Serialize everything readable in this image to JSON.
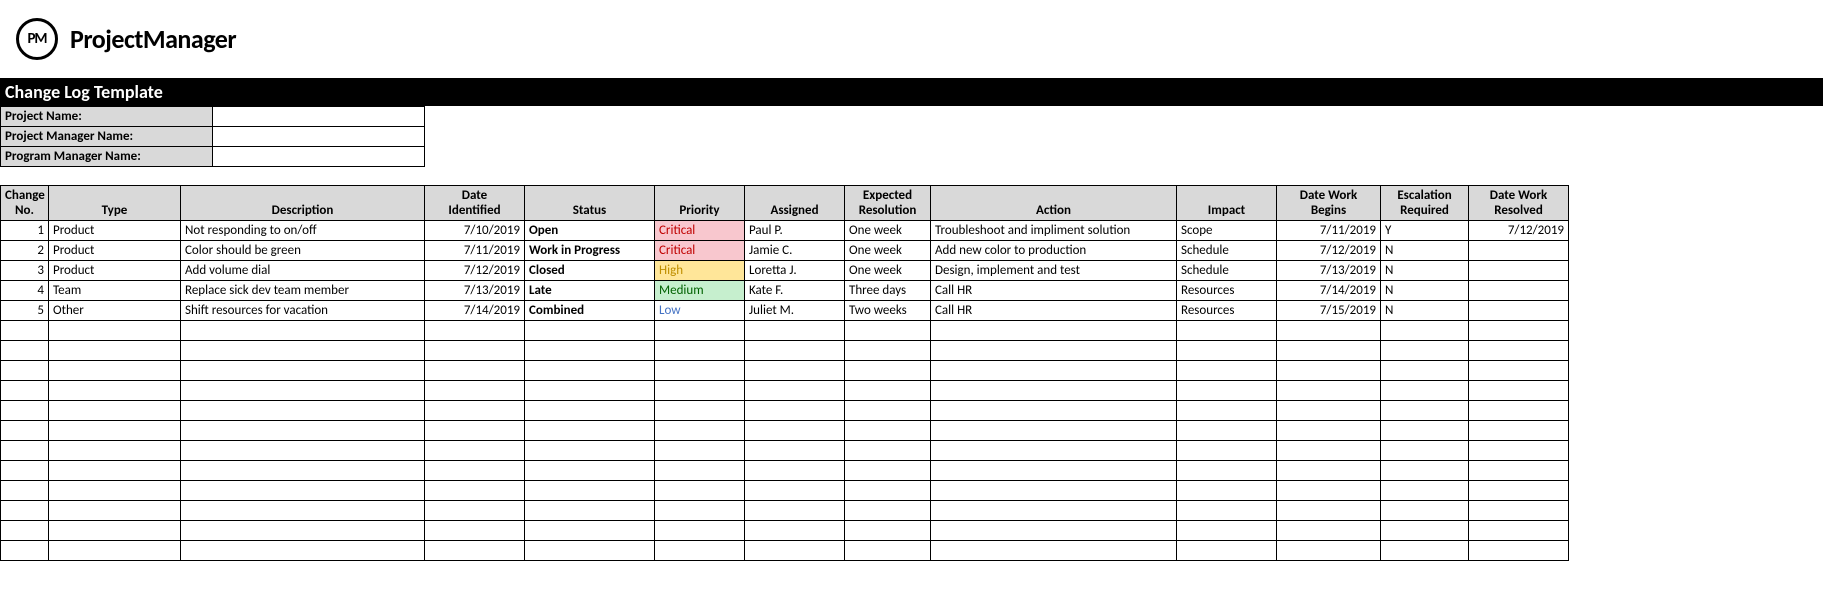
{
  "logo": {
    "badge": "PM",
    "text": "ProjectManager"
  },
  "title": "Change Log Template",
  "meta": {
    "project_name_label": "Project Name:",
    "project_name_value": "",
    "pm_name_label": "Project Manager Name:",
    "pm_name_value": "",
    "prog_name_label": "Program Manager Name:",
    "prog_name_value": ""
  },
  "headers": {
    "no": "Change No.",
    "type": "Type",
    "desc": "Description",
    "date_id": "Date Identified",
    "status": "Status",
    "priority": "Priority",
    "assigned": "Assigned",
    "expected": "Expected Resolution",
    "action": "Action",
    "impact": "Impact",
    "date_begins": "Date Work Begins",
    "escalation": "Escalation Required",
    "date_resolved": "Date Work Resolved"
  },
  "rows": [
    {
      "no": "1",
      "type": "Product",
      "desc": "Not responding to on/off",
      "date_id": "7/10/2019",
      "status": "Open",
      "priority": "Critical",
      "priority_class": "pri-critical",
      "assigned": "Paul P.",
      "expected": "One week",
      "action": "Troubleshoot and impliment solution",
      "impact": "Scope",
      "date_begins": "7/11/2019",
      "escalation": "Y",
      "date_resolved": "7/12/2019"
    },
    {
      "no": "2",
      "type": "Product",
      "desc": "Color should be green",
      "date_id": "7/11/2019",
      "status": "Work in Progress",
      "priority": "Critical",
      "priority_class": "pri-critical",
      "assigned": "Jamie C.",
      "expected": "One week",
      "action": "Add new color to production",
      "impact": "Schedule",
      "date_begins": "7/12/2019",
      "escalation": "N",
      "date_resolved": ""
    },
    {
      "no": "3",
      "type": "Product",
      "desc": "Add volume dial",
      "date_id": "7/12/2019",
      "status": "Closed",
      "priority": "High",
      "priority_class": "pri-high",
      "assigned": "Loretta J.",
      "expected": "One week",
      "action": "Design, implement and test",
      "impact": "Schedule",
      "date_begins": "7/13/2019",
      "escalation": "N",
      "date_resolved": ""
    },
    {
      "no": "4",
      "type": "Team",
      "desc": "Replace sick dev team member",
      "date_id": "7/13/2019",
      "status": "Late",
      "priority": "Medium",
      "priority_class": "pri-medium",
      "assigned": "Kate F.",
      "expected": "Three days",
      "action": "Call HR",
      "impact": "Resources",
      "date_begins": "7/14/2019",
      "escalation": "N",
      "date_resolved": ""
    },
    {
      "no": "5",
      "type": "Other",
      "desc": "Shift resources for vacation",
      "date_id": "7/14/2019",
      "status": "Combined",
      "priority": "Low",
      "priority_class": "pri-low",
      "assigned": "Juliet M.",
      "expected": "Two weeks",
      "action": "Call HR",
      "impact": "Resources",
      "date_begins": "7/15/2019",
      "escalation": "N",
      "date_resolved": ""
    }
  ],
  "empty_rows": 12
}
